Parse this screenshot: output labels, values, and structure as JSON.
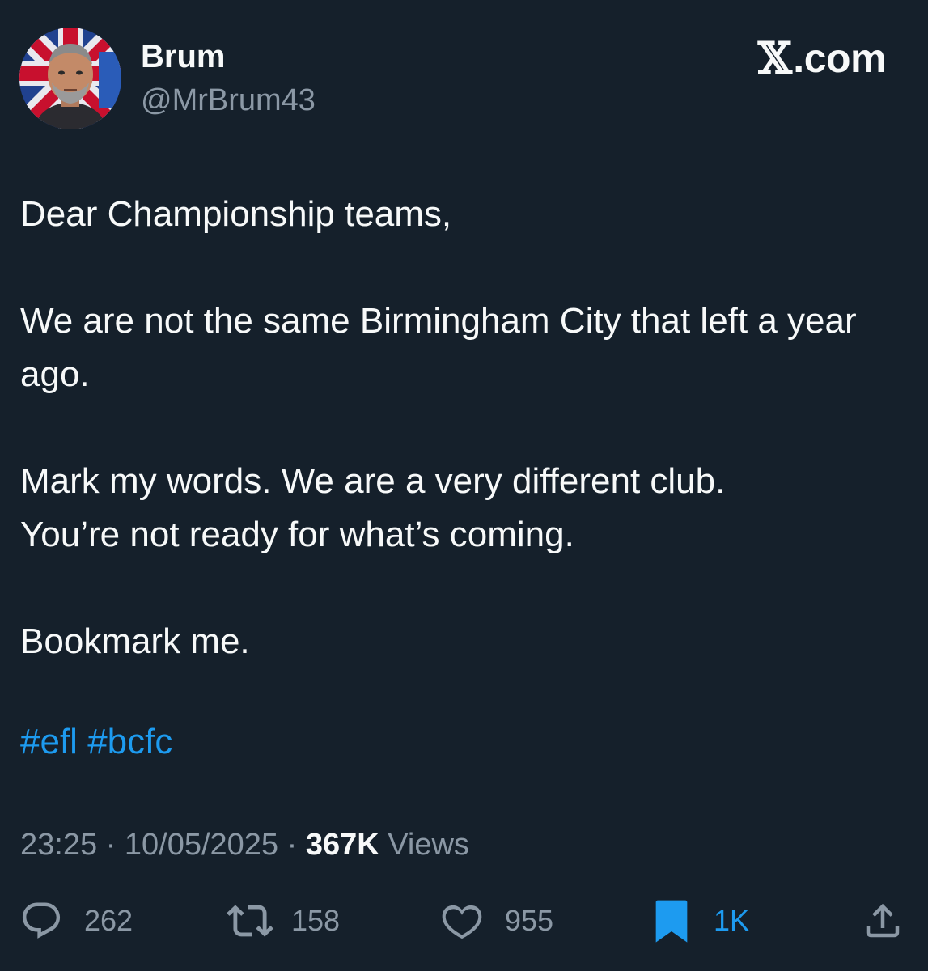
{
  "author": {
    "display_name": "Brum",
    "handle": "@MrBrum43"
  },
  "brand": {
    "text": ".com",
    "logo_icon": "x-logo-icon"
  },
  "tweet": {
    "paragraphs": [
      "Dear Championship teams,",
      "We are not the same Birmingham City that left a year ago.",
      "Mark my words. We are a very different club.",
      "You’re not ready for what’s coming.",
      "Bookmark me."
    ],
    "hashtags": [
      "#efl",
      "#bcfc"
    ]
  },
  "meta": {
    "time": "23:25",
    "separator": "·",
    "date": "10/05/2025",
    "views_count": "367K",
    "views_label": "Views"
  },
  "actions": {
    "replies": "262",
    "reposts": "158",
    "likes": "955",
    "bookmarks": "1K"
  },
  "colors": {
    "background": "#15202b",
    "text": "#f7f9f9",
    "secondary": "#8b98a5",
    "accent": "#1d9bf0"
  }
}
